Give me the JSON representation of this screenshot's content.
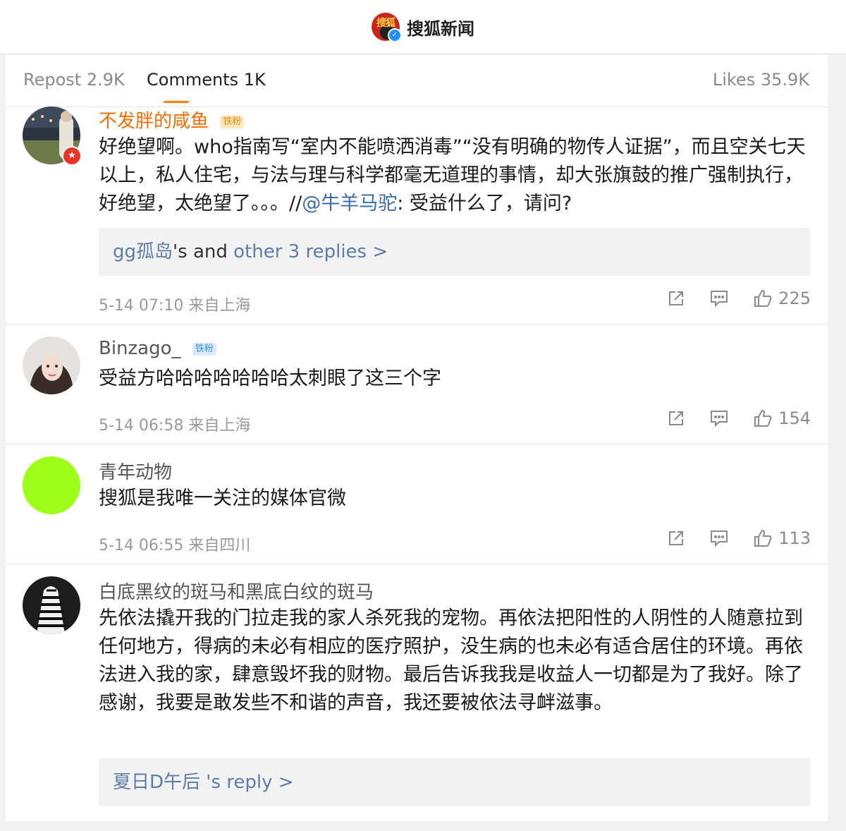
{
  "header": {
    "logo_text": "搜狐",
    "title": "搜狐新闻"
  },
  "tabs": [
    {
      "label": "Repost 2.9K"
    },
    {
      "label": "Comments 1K"
    },
    {
      "label": "Likes 35.9K"
    }
  ],
  "comments": [
    {
      "username": "不发胖的咸鱼",
      "fan_badge": "铁粉",
      "text": "好绝望啊。who指南写“室内不能喷洒消毒”“没有明确的物传人证据”，而且空关七天以上，私人住宅，与法与理与科学都毫无道理的事情，却大张旗鼓的推广强制执行，好绝望，太绝望了。。。//",
      "mention": "@牛羊马驼",
      "text_after": ": 受益什么了，请问?",
      "replies": {
        "user": "gg孤岛",
        "mid": "'s and ",
        "link": "other 3 replies >"
      },
      "time": "5-14 07:10",
      "location": "来自上海",
      "likes": "225"
    },
    {
      "username": "Binzago_",
      "fan_badge": "铁粉",
      "text": "受益方哈哈哈哈哈哈哈太刺眼了这三个字",
      "time": "5-14 06:58",
      "location": "来自上海",
      "likes": "154"
    },
    {
      "username": "青年动物",
      "text": "搜狐是我唯一关注的媒体官微",
      "time": "5-14 06:55",
      "location": "来自四川",
      "likes": "113"
    },
    {
      "username": "白底黑纹的斑马和黑底白纹的斑马",
      "text": "先依法撬开我的门拉走我的家人杀死我的宠物。再依法把阳性的人阴性的人随意拉到任何地方，得病的未必有相应的医疗照护，没生病的也未必有适合居住的环境。再依法进入我的家，肆意毁坏我的财物。最后告诉我我是收益人一切都是为了我好。除了感谢，我要是敢发些不和谐的声音，我还要被依法寻衅滋事。",
      "replies": {
        "user": "夏日D午后",
        "link": " 's reply >"
      }
    }
  ],
  "colors": {
    "accent": "#ff8200",
    "link": "#3b6ea8",
    "vip_name": "#f36d00"
  },
  "icons": [
    "share-icon",
    "comment-icon",
    "like-icon",
    "verified-icon"
  ]
}
